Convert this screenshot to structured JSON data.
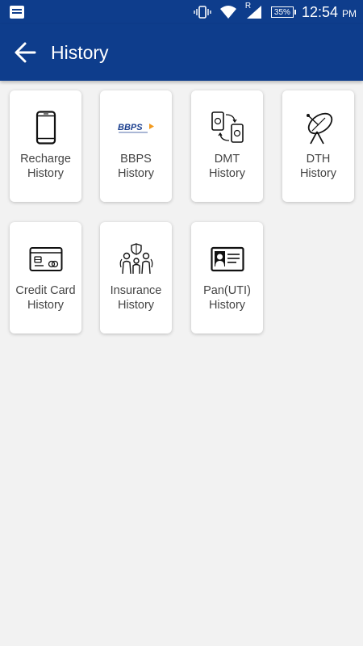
{
  "status_bar": {
    "battery": "35%",
    "network_indicator": "R",
    "time": "12:54",
    "time_suffix": "PM"
  },
  "app_bar": {
    "title": "History",
    "back_icon": "arrow-left-icon"
  },
  "colors": {
    "primary": "#0e3d8c",
    "background": "#f2f2f2",
    "card": "#ffffff",
    "label": "#444444"
  },
  "tiles": [
    {
      "line1": "Recharge",
      "line2": "History",
      "icon": "mobile-phone-icon"
    },
    {
      "line1": "BBPS",
      "line2": "History",
      "icon": "bbps-logo-icon",
      "logo_text": "BBPS"
    },
    {
      "line1": "DMT",
      "line2": "History",
      "icon": "money-transfer-icon"
    },
    {
      "line1": "DTH",
      "line2": "History",
      "icon": "satellite-dish-icon"
    },
    {
      "line1": "Credit Card",
      "line2": "History",
      "icon": "credit-card-icon"
    },
    {
      "line1": "Insurance",
      "line2": "History",
      "icon": "family-insurance-icon"
    },
    {
      "line1": "Pan(UTI)",
      "line2": "History",
      "icon": "id-card-icon"
    }
  ]
}
